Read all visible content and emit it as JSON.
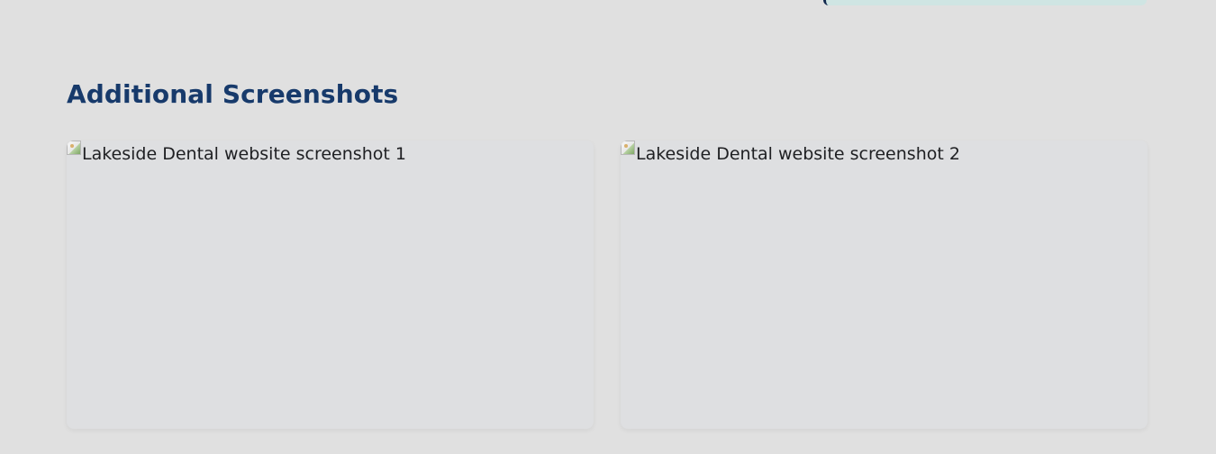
{
  "section": {
    "title": "Additional Screenshots"
  },
  "screenshots": [
    {
      "alt": "Lakeside Dental website screenshot 1",
      "icon": "broken-image-icon"
    },
    {
      "alt": "Lakeside Dental website screenshot 2",
      "icon": "broken-image-icon"
    }
  ],
  "colors": {
    "background": "#e0e0e0",
    "title": "#173a6b",
    "card": "#dedfe1",
    "accent_strip": "#cfe5e3"
  }
}
